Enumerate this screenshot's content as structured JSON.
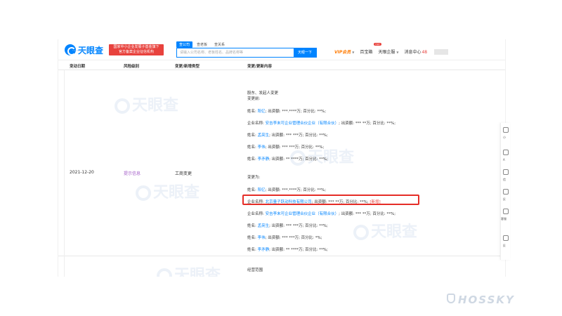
{
  "header": {
    "logo_text": "天眼查",
    "logo_sub": "TianYanCha.com",
    "slogan_line1": "国家中小企业发展子基金旗下",
    "slogan_line2": "官方备案企业征信机构",
    "search_tabs": [
      "查公司",
      "查老板",
      "查关系"
    ],
    "search_placeholder": "请输入公司名称、老板姓名、品牌名称等",
    "search_button": "天眼一下",
    "nav": {
      "vip": "VIP会员",
      "baibaoxiang": "百宝箱",
      "hot": "HOT",
      "tianyan_enterprise": "天眼企服",
      "messages": "消息中心",
      "message_count": "48"
    }
  },
  "table": {
    "headers": [
      "变动日期",
      "风险级别",
      "变更/新增类型",
      "变更/更新内容"
    ],
    "row": {
      "date": "2021-12-20",
      "risk": "提示信息",
      "type": "工商变更",
      "section_title": "股东、发起人变更",
      "before_label": "变更前:",
      "after_label": "变更为:",
      "before": [
        {
          "prefix": "姓名: ",
          "name": "阳亿",
          "rest": "; 出资额: ***.****万; 百分比: **%;"
        },
        {
          "prefix": "企业名称: ",
          "name": "安吉李末可企业管理合伙企业（有限合伙）",
          "rest": "; 出资额: *** **万; 百分比: **%;"
        },
        {
          "prefix": "姓名: ",
          "name": "孟亮生",
          "rest": "; 出资额: *** ***万; 百分比: **%;"
        },
        {
          "prefix": "姓名: ",
          "name": "李伟",
          "rest": "; 出资额: *** ***万; 百分比: **%;"
        },
        {
          "prefix": "姓名: ",
          "name": "李矛静",
          "rest": "; 出资额: ** ****万; 百分比: **%;"
        }
      ],
      "after": [
        {
          "prefix": "姓名: ",
          "name": "阳亿",
          "rest": "; 出资额: ***.****万; 百分比: **%;"
        },
        {
          "prefix": "企业名称: ",
          "name": "北京量子跃动科技有限公司",
          "rest": "; 出资额: *** **万; 百分比: **%;",
          "tag": "[新增]"
        },
        {
          "prefix": "企业名称: ",
          "name": "安吉李末可企业管理合伙企业（有限合伙）",
          "rest": "; 出资额: *** **万; 百分比: **%;"
        },
        {
          "prefix": "姓名: ",
          "name": "孟亮生",
          "rest": "; 出资额: *** ***万; 百分比: **%;"
        },
        {
          "prefix": "姓名: ",
          "name": "李伟",
          "rest": "; 出资额: *** ***万; 百分比: *%;"
        },
        {
          "prefix": "姓名: ",
          "name": "李矛静",
          "rest": "; 出资额: ** ****万; 百分比: **%;"
        }
      ],
      "next_section_title": "经营范围"
    }
  },
  "watermark_text": "天眼查",
  "watermark_sub": "TianYanCha.com",
  "side_toolbar": [
    "小",
    "A",
    "信",
    "反",
    "客服",
    "反"
  ],
  "brand": "HOSSKY",
  "colors": {
    "primary": "#0084ff",
    "vip": "#ff7a00",
    "risk": "#a560c9",
    "highlight": "#e52d27",
    "new_tag": "#e8423d"
  }
}
